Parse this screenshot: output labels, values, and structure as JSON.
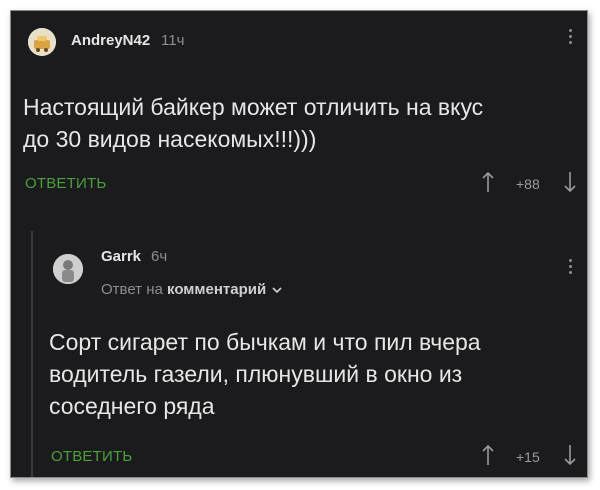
{
  "comment": {
    "author": "AndreyN42",
    "time": "11ч",
    "text": "Настоящий байкер может отличить на вкус\nдо 30 видов насекомых!!!)))",
    "reply_label": "ОТВЕТИТЬ",
    "rating": "+88"
  },
  "reply": {
    "author": "Garrk",
    "time": "6ч",
    "reply_to_prefix": "Ответ на",
    "reply_to_target": "комментарий",
    "text": "Сорт сигарет по бычкам и что пил вчера\nводитель газели, плюнувший в окно из\nсоседнего ряда",
    "reply_label": "ОТВЕТИТЬ",
    "rating": "+15"
  },
  "icons": {
    "upvote": "arrow-up-icon",
    "downvote": "arrow-down-icon",
    "menu": "more-vertical-icon",
    "expand": "chevron-down-icon"
  },
  "colors": {
    "background": "#1b1b1d",
    "accent": "#4aa13a",
    "text": "#e6e6e6",
    "muted": "#8d8d8d"
  }
}
